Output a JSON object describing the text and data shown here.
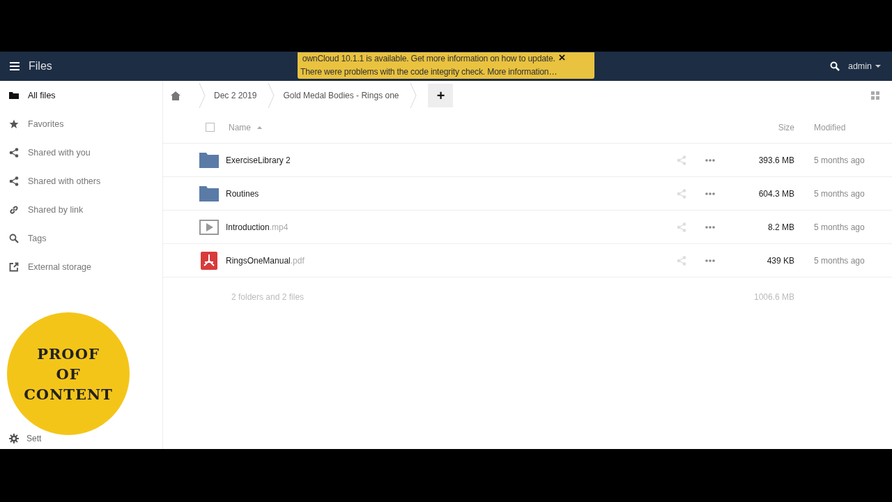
{
  "header": {
    "app_title": "Files",
    "user": "admin"
  },
  "notification": {
    "lines": [
      "ownCloud 10.1.1 is available. Get more information on how to update.",
      "There were problems with the code integrity check. More information…"
    ],
    "close": "×"
  },
  "sidebar": {
    "items": [
      {
        "label": "All files",
        "kind": "folder",
        "selected": true
      },
      {
        "label": "Favorites",
        "kind": "star",
        "selected": false
      },
      {
        "label": "Shared with you",
        "kind": "share",
        "selected": false
      },
      {
        "label": "Shared with others",
        "kind": "share",
        "selected": false
      },
      {
        "label": "Shared by link",
        "kind": "link",
        "selected": false
      },
      {
        "label": "Tags",
        "kind": "search",
        "selected": false
      },
      {
        "label": "External storage",
        "kind": "external",
        "selected": false
      }
    ],
    "settings": "Sett"
  },
  "sticker": {
    "lines": [
      "PROOF",
      "OF",
      "CONTENT"
    ]
  },
  "breadcrumbs": [
    "Dec 2 2019",
    "Gold Medal Bodies - Rings one"
  ],
  "new_button": "+",
  "table": {
    "select_all_checked": false,
    "columns": [
      "Name",
      "Size",
      "Modified"
    ],
    "rows": [
      {
        "kind": "folder",
        "name": "ExerciseLibrary 2",
        "size": "393.6 MB",
        "modified": "5 months ago"
      },
      {
        "kind": "folder",
        "name": "Routines",
        "size": "604.3 MB",
        "modified": "5 months ago"
      },
      {
        "kind": "video",
        "name": "Introduction",
        "ext": ".mp4",
        "size": "8.2 MB",
        "modified": "5 months ago"
      },
      {
        "kind": "pdf",
        "name": "RingsOneManual",
        "ext": ".pdf",
        "size": "439 KB",
        "modified": "5 months ago"
      }
    ],
    "summary": {
      "count": "2 folders and 2 files",
      "size": "1006.6 MB"
    }
  }
}
